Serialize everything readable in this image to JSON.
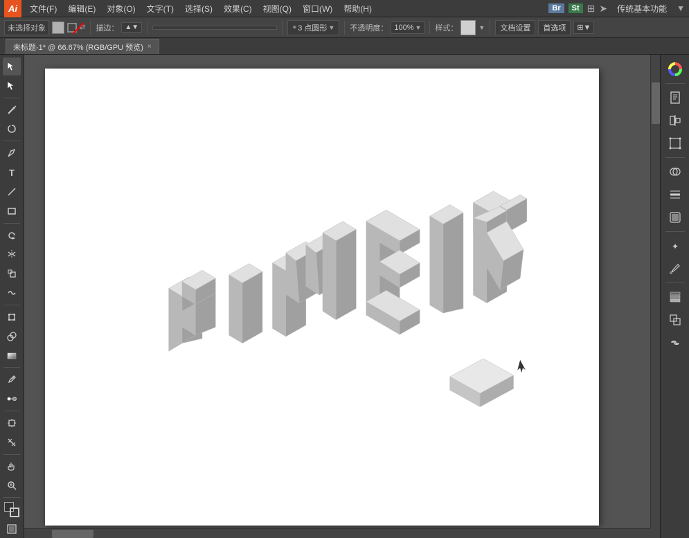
{
  "app": {
    "logo": "Ai",
    "title": "传统基本功能",
    "logo_bg": "#e8531f"
  },
  "menubar": {
    "items": [
      "文件(F)",
      "编辑(E)",
      "对象(O)",
      "文字(T)",
      "选择(S)",
      "效果(C)",
      "视图(Q)",
      "窗口(W)",
      "帮助(H)"
    ]
  },
  "topbar_right": {
    "bridge": "Br",
    "stock": "St",
    "mode_label": "传统基本功能",
    "arrow_icon": "→"
  },
  "toolbar": {
    "no_selection": "未选择对象",
    "stroke_label": "描边：",
    "shape_label": "3 点圆形",
    "opacity_label": "不透明度：",
    "opacity_value": "100%",
    "style_label": "样式：",
    "doc_settings": "文档设置",
    "preferences": "首选项"
  },
  "tab": {
    "title": "未标题-1*",
    "zoom": "66.67%",
    "mode": "RGB/GPU 预览",
    "close": "×"
  },
  "left_tools": [
    {
      "name": "selection-tool",
      "icon": "↖",
      "active": true
    },
    {
      "name": "direct-selection-tool",
      "icon": "↗"
    },
    {
      "name": "magic-wand-tool",
      "icon": "✦"
    },
    {
      "name": "lasso-tool",
      "icon": "⌀"
    },
    {
      "name": "pen-tool",
      "icon": "✒"
    },
    {
      "name": "type-tool",
      "icon": "T"
    },
    {
      "name": "line-tool",
      "icon": "╱"
    },
    {
      "name": "rectangle-tool",
      "icon": "▭"
    },
    {
      "name": "rotate-tool",
      "icon": "↻"
    },
    {
      "name": "reflect-tool",
      "icon": "↔"
    },
    {
      "name": "scale-tool",
      "icon": "⤢"
    },
    {
      "name": "warp-tool",
      "icon": "⌖"
    },
    {
      "name": "width-tool",
      "icon": "⟺"
    },
    {
      "name": "free-transform-tool",
      "icon": "⊞"
    },
    {
      "name": "shape-builder-tool",
      "icon": "⊕"
    },
    {
      "name": "gradient-tool",
      "icon": "▓"
    },
    {
      "name": "eyedropper-tool",
      "icon": "🔬"
    },
    {
      "name": "blend-tool",
      "icon": "8"
    },
    {
      "name": "artboard-tool",
      "icon": "⊡"
    },
    {
      "name": "slice-tool",
      "icon": "⛶"
    },
    {
      "name": "hand-tool",
      "icon": "✋"
    },
    {
      "name": "zoom-tool",
      "icon": "🔍"
    },
    {
      "name": "fill-color",
      "icon": "■"
    },
    {
      "name": "change-screen-mode",
      "icon": "▣"
    }
  ],
  "right_panel": {
    "icons": [
      "🎨",
      "📄",
      "⊞",
      "⊟",
      "⊕",
      "⊖",
      "≡",
      "▭",
      "◎",
      "✦",
      "⊞",
      "🔢",
      "↗"
    ]
  },
  "canvas": {
    "artboard_bg": "#ffffff",
    "zoom_level": "66.67%",
    "cursor_visible": true
  },
  "isometric_text": {
    "content": "UIMEIR",
    "description": "3D isometric block letters in gray tones"
  }
}
